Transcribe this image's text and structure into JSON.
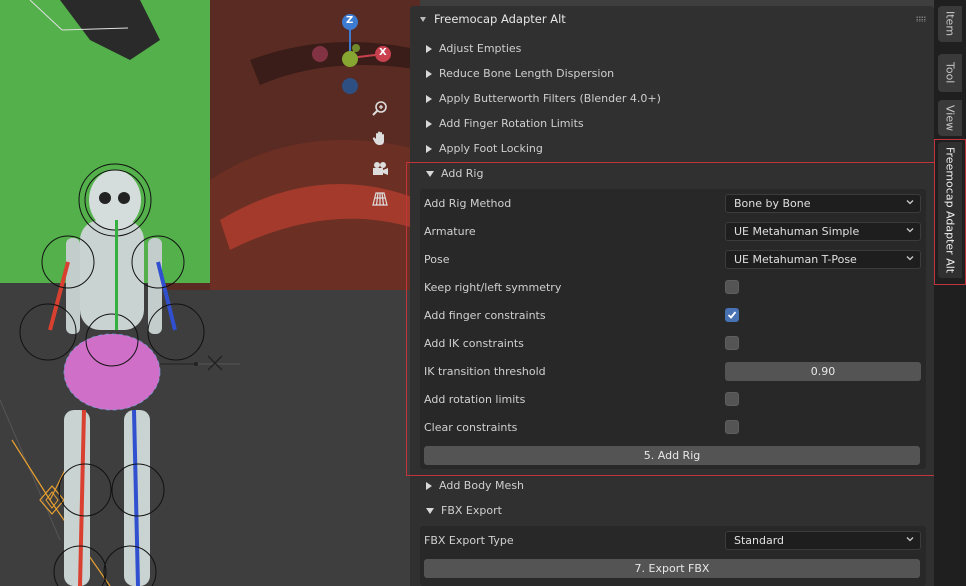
{
  "panel": {
    "title": "Freemocap Adapter Alt",
    "sections": {
      "adjust_empties": "Adjust Empties",
      "reduce_bone": "Reduce Bone Length Dispersion",
      "butterworth": "Apply Butterworth Filters (Blender 4.0+)",
      "finger_limits": "Add Finger Rotation Limits",
      "foot_locking": "Apply Foot Locking",
      "add_rig": "Add Rig",
      "add_body_mesh": "Add Body Mesh",
      "fbx_export": "FBX Export"
    },
    "add_rig": {
      "method_label": "Add Rig Method",
      "method_value": "Bone by Bone",
      "armature_label": "Armature",
      "armature_value": "UE Metahuman Simple",
      "pose_label": "Pose",
      "pose_value": "UE Metahuman T-Pose",
      "symmetry_label": "Keep right/left symmetry",
      "symmetry_checked": false,
      "finger_label": "Add finger constraints",
      "finger_checked": true,
      "ik_label": "Add IK constraints",
      "ik_checked": false,
      "ik_threshold_label": "IK transition threshold",
      "ik_threshold_value": "0.90",
      "rotation_label": "Add rotation limits",
      "rotation_checked": false,
      "clear_label": "Clear constraints",
      "clear_checked": false,
      "button": "5. Add Rig"
    },
    "fbx": {
      "type_label": "FBX Export Type",
      "type_value": "Standard",
      "button": "7. Export FBX"
    }
  },
  "tabs": {
    "item": "Item",
    "tool": "Tool",
    "view": "View",
    "addon": "Freemocap Adapter Alt"
  },
  "gizmo": {
    "z_label": "Z",
    "x_label": "X",
    "x_color": "#c9414f",
    "y_color": "#86a531",
    "z_color": "#3d7bd1"
  },
  "colors": {
    "accent_red": "#c0353b",
    "checkbox_on": "#4772b3"
  }
}
